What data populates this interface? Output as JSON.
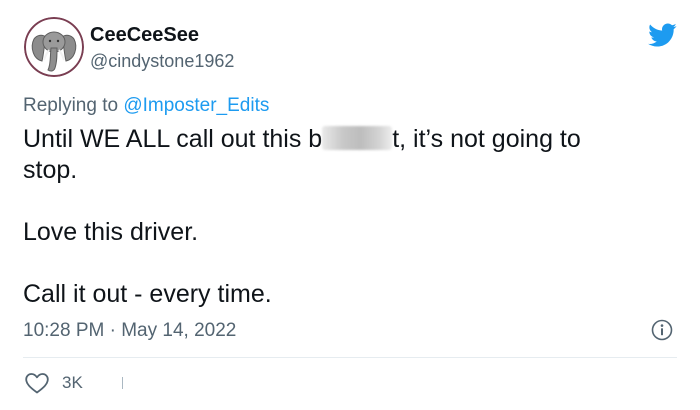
{
  "author": {
    "display_name": "CeeCeeSee",
    "handle": "@cindystone1962",
    "avatar_icon": "elephant-avatar-icon"
  },
  "brand": {
    "logo_icon": "twitter-bird-icon",
    "accent_color": "#1d9bf0"
  },
  "reply": {
    "prefix": "Replying to ",
    "mention": "@Imposter_Edits"
  },
  "tweet": {
    "line1_before": "Until WE ALL call out this b",
    "line1_after": "t, it’s not going to",
    "line2": "stop.",
    "para2": "Love this driver.",
    "para3": "Call it out - every time."
  },
  "meta": {
    "timestamp": "10:28 PM · May 14, 2022",
    "info_icon": "info-icon"
  },
  "actions": {
    "like_icon": "heart-icon",
    "like_count": "3K"
  },
  "colors": {
    "text": "#0f1419",
    "muted": "#536471",
    "link": "#1d9bf0",
    "divider": "#e6ecf0"
  }
}
